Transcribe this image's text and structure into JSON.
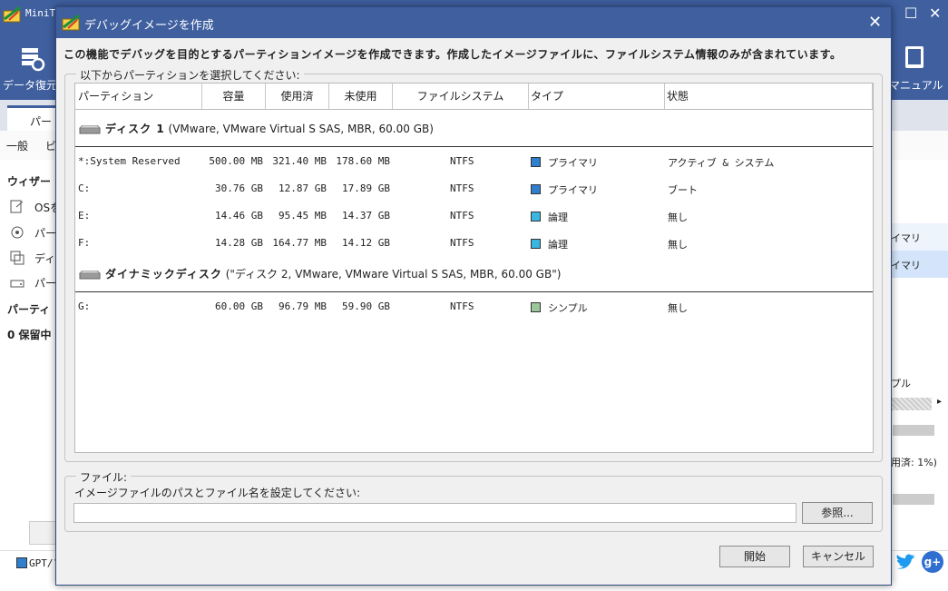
{
  "colors": {
    "titlebar": "#3f5f9f",
    "primary_swatch": "#2f7fcf",
    "logical_swatch": "#3bb6e0",
    "simple_swatch": "#9bc79b"
  },
  "background_app": {
    "title": "MiniT",
    "toolbar": {
      "data_recovery_label": "データ復元",
      "manual_label": "マニュアル"
    },
    "tab_label": "パー",
    "menu": {
      "general": "一般",
      "view": "ビ"
    },
    "sidebar": {
      "wizard_heading": "ウィザー",
      "items": [
        "OSを",
        "パー",
        "ディ",
        "パー"
      ],
      "partition_heading": "パーティ",
      "pending": "0 保留中"
    },
    "right_panel": {
      "row1": "イマリ",
      "row2": "イマリ",
      "simple": "プル",
      "used": "用済: 1%)"
    },
    "footer_legend": "GPT/フ"
  },
  "dialog": {
    "title": "デバッグイメージを作成",
    "close_glyph": "✕",
    "description": "この機能でデバッグを目的とするパーティションイメージを作成できます。作成したイメージファイルに、ファイルシステム情報のみが含まれています。",
    "partition_group_legend": "以下からパーティションを選択してください:",
    "columns": {
      "partition": "パーティション",
      "capacity": "容量",
      "used": "使用済",
      "unused": "未使用",
      "filesystem": "ファイルシステム",
      "type": "タイプ",
      "status": "状態"
    },
    "disks": [
      {
        "name": "ディスク 1",
        "detail": "(VMware, VMware Virtual S SAS, MBR, 60.00 GB)",
        "partitions": [
          {
            "name": "*:System Reserved",
            "capacity": "500.00 MB",
            "used": "321.40 MB",
            "unused": "178.60 MB",
            "fs": "NTFS",
            "type": "プライマリ",
            "type_color": "#2f7fcf",
            "status": "アクティブ & システム"
          },
          {
            "name": "C:",
            "capacity": "30.76 GB",
            "used": "12.87 GB",
            "unused": "17.89 GB",
            "fs": "NTFS",
            "type": "プライマリ",
            "type_color": "#2f7fcf",
            "status": "ブート"
          },
          {
            "name": "E:",
            "capacity": "14.46 GB",
            "used": "95.45 MB",
            "unused": "14.37 GB",
            "fs": "NTFS",
            "type": "論理",
            "type_color": "#3bb6e0",
            "status": "無し"
          },
          {
            "name": "F:",
            "capacity": "14.28 GB",
            "used": "164.77 MB",
            "unused": "14.12 GB",
            "fs": "NTFS",
            "type": "論理",
            "type_color": "#3bb6e0",
            "status": "無し"
          }
        ]
      },
      {
        "name": "ダイナミックディスク",
        "detail": "(\"ディスク 2, VMware, VMware Virtual S SAS, MBR, 60.00 GB\")",
        "partitions": [
          {
            "name": "G:",
            "capacity": "60.00 GB",
            "used": "96.79 MB",
            "unused": "59.90 GB",
            "fs": "NTFS",
            "type": "シンプル",
            "type_color": "#9bc79b",
            "status": "無し"
          }
        ]
      }
    ],
    "file_group_legend": "ファイル:",
    "file_prompt": "イメージファイルのパスとファイル名を設定してください:",
    "file_path_value": "",
    "browse_label": "参照...",
    "start_label": "開始",
    "cancel_label": "キャンセル"
  }
}
